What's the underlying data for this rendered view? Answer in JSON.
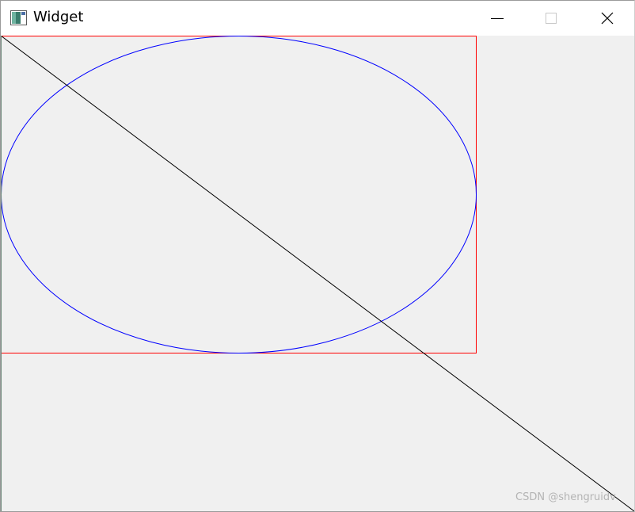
{
  "window": {
    "title": "Widget",
    "icon": "qt-app-icon",
    "controls": {
      "minimize_icon": "minimize-icon",
      "maximize_icon": "maximize-icon",
      "close_icon": "close-icon"
    }
  },
  "drawing": {
    "background": "#f0f0f0",
    "shapes": [
      {
        "kind": "rectangle",
        "stroke": "#ff0000"
      },
      {
        "kind": "ellipse",
        "stroke": "#0000ff"
      },
      {
        "kind": "line",
        "stroke": "#000000"
      }
    ]
  },
  "watermark": {
    "text": "CSDN @shengruidv"
  }
}
